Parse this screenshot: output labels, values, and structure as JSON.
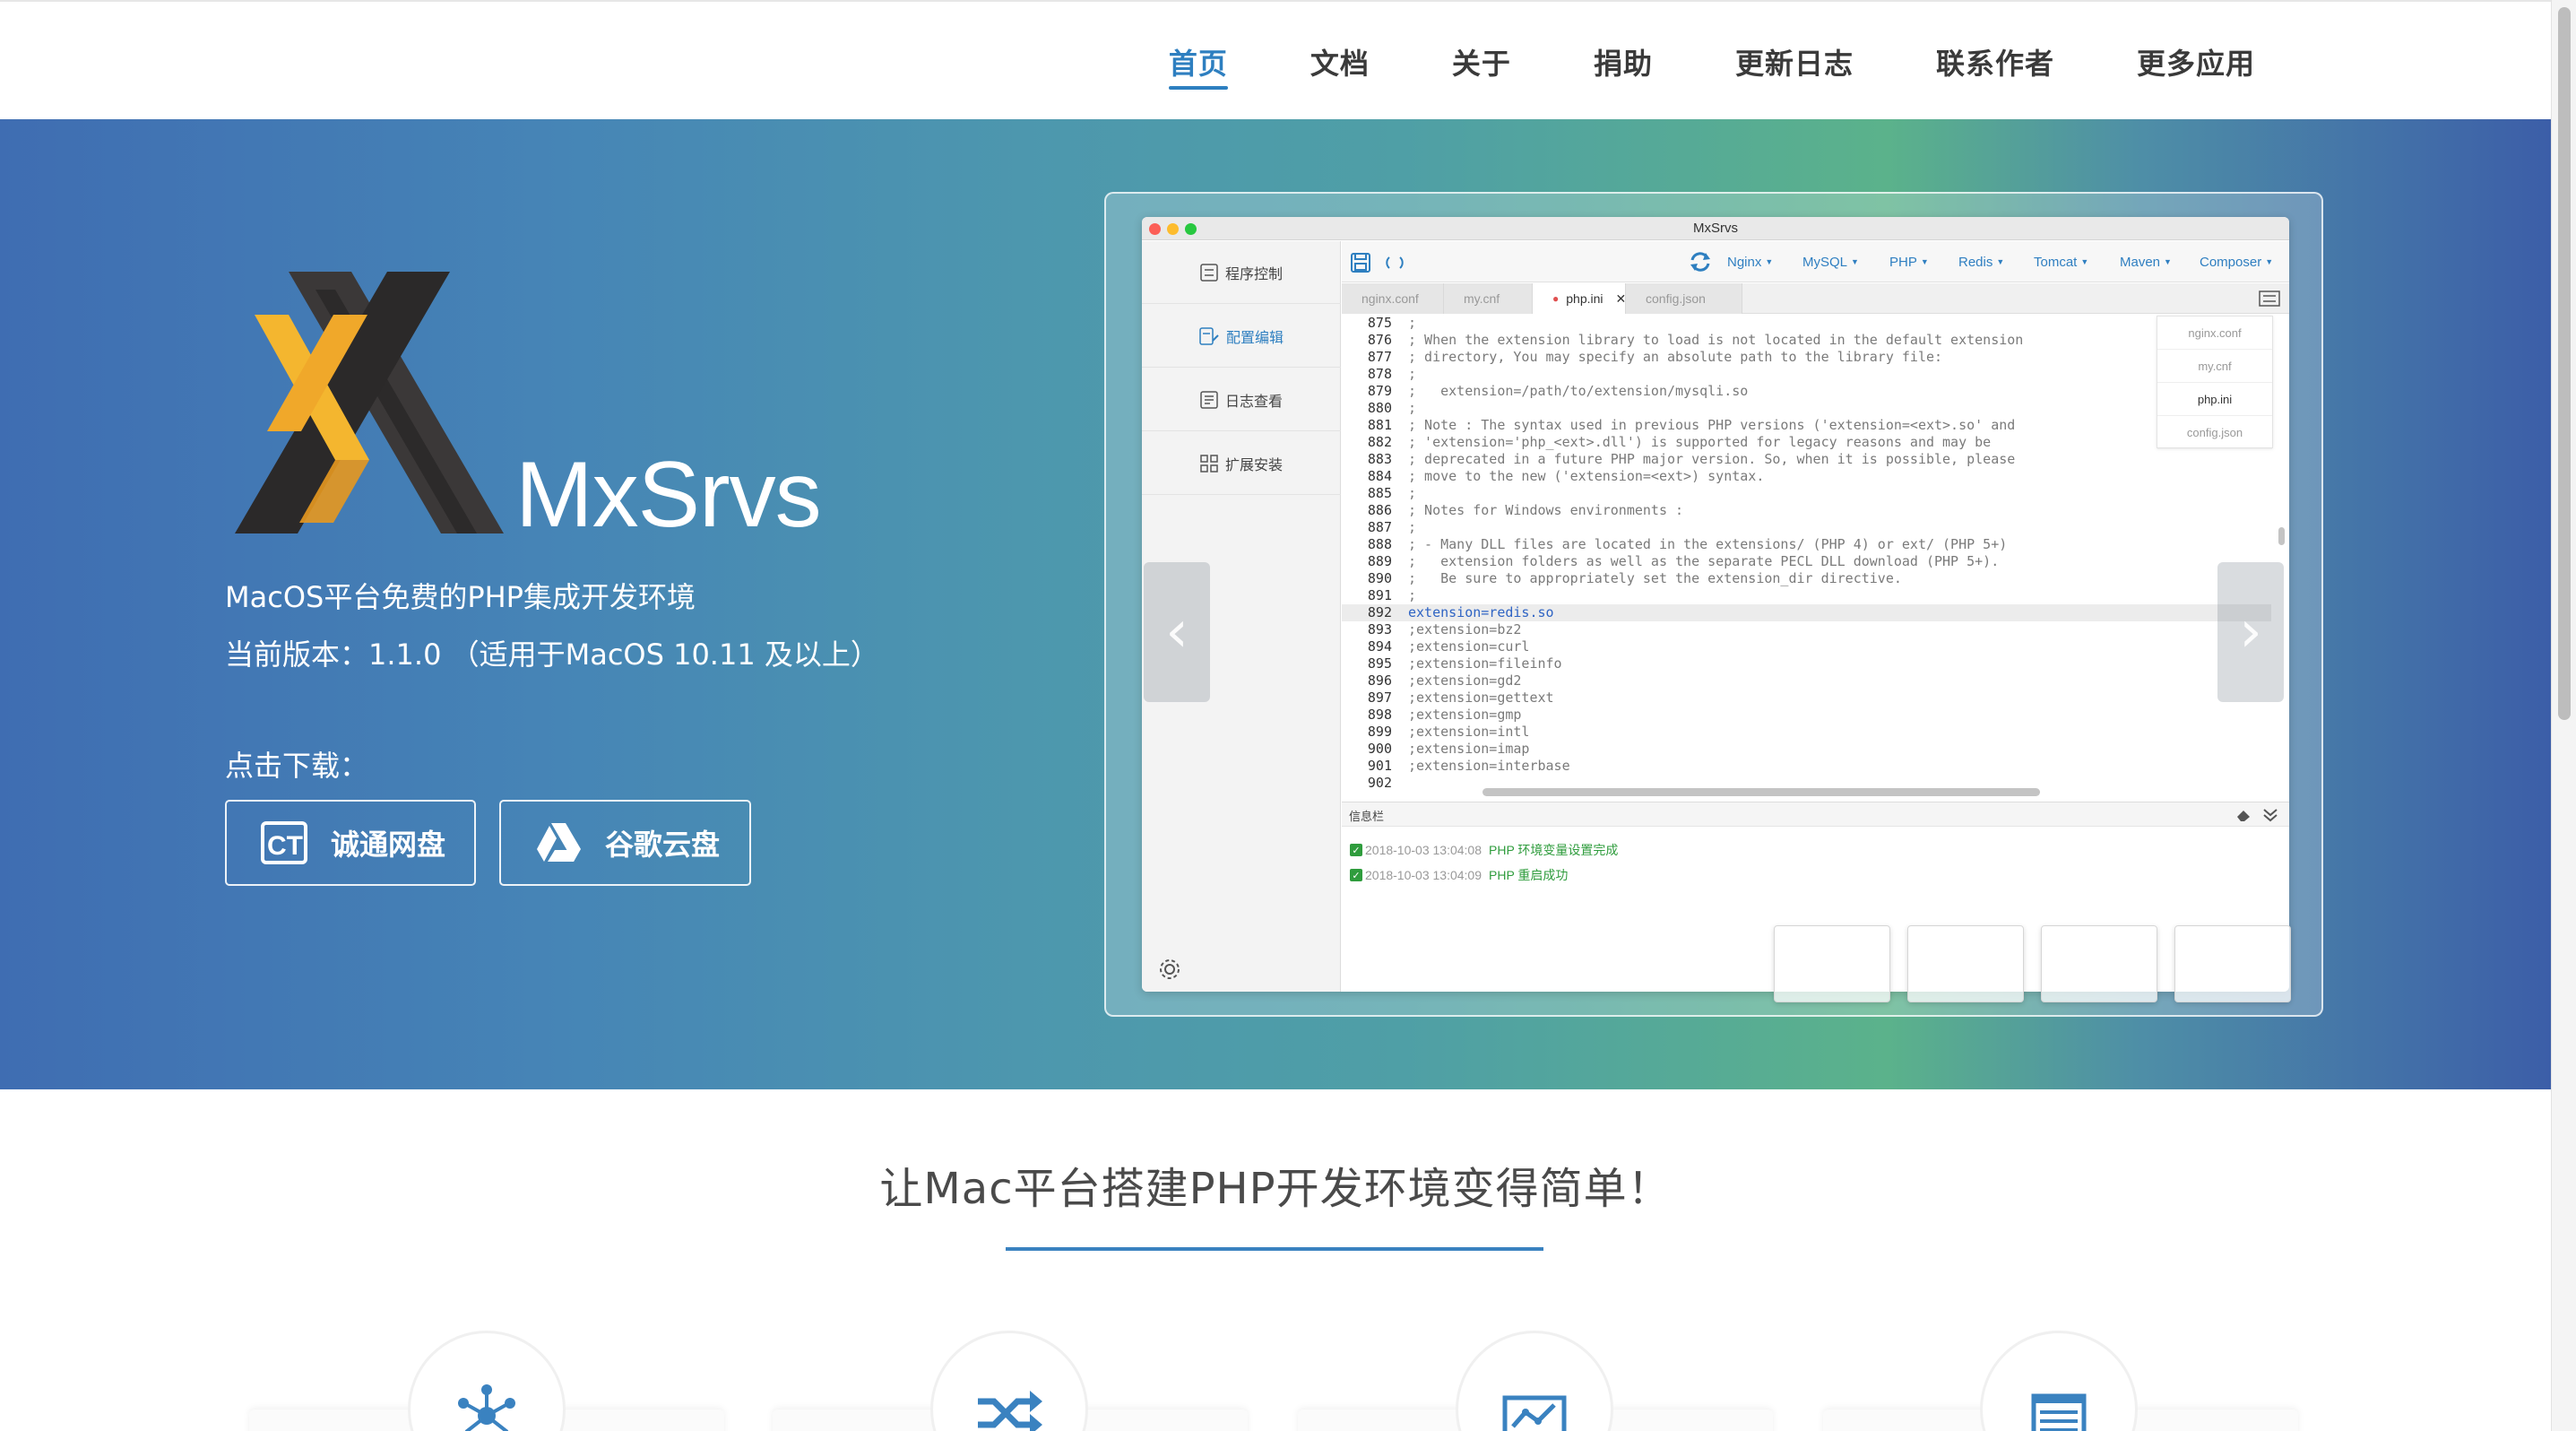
{
  "nav": {
    "items": [
      "首页",
      "文档",
      "关于",
      "捐助",
      "更新日志",
      "联系作者",
      "更多应用"
    ],
    "active_index": 0
  },
  "hero": {
    "brand": "MxSrvs",
    "subtitle": "MacOS平台免费的PHP集成开发环境",
    "version": "当前版本：1.1.0 （适用于MacOS 10.11 及以上）",
    "download_label": "点击下载：",
    "buttons": {
      "ct": "诚通网盘",
      "ct_icon_text": "CT",
      "google": "谷歌云盘"
    }
  },
  "app": {
    "title": "MxSrvs",
    "sidebar": [
      "程序控制",
      "配置编辑",
      "日志查看",
      "扩展安装"
    ],
    "sidebar_active": 1,
    "menus": [
      "Nginx",
      "MySQL",
      "PHP",
      "Redis",
      "Tomcat",
      "Maven",
      "Composer"
    ],
    "tabs": [
      "nginx.conf",
      "my.cnf",
      "php.ini",
      "config.json"
    ],
    "active_tab": "php.ini",
    "files": [
      "nginx.conf",
      "my.cnf",
      "php.ini",
      "config.json"
    ],
    "code": [
      {
        "n": "875",
        "t": ";"
      },
      {
        "n": "876",
        "t": "; When the extension library to load is not located in the default extension"
      },
      {
        "n": "877",
        "t": "; directory, You may specify an absolute path to the library file:"
      },
      {
        "n": "878",
        "t": ";"
      },
      {
        "n": "879",
        "t": ";   extension=/path/to/extension/mysqli.so"
      },
      {
        "n": "880",
        "t": ";"
      },
      {
        "n": "881",
        "t": "; Note : The syntax used in previous PHP versions ('extension=<ext>.so' and"
      },
      {
        "n": "882",
        "t": "; 'extension='php_<ext>.dll') is supported for legacy reasons and may be"
      },
      {
        "n": "883",
        "t": "; deprecated in a future PHP major version. So, when it is possible, please"
      },
      {
        "n": "884",
        "t": "; move to the new ('extension=<ext>) syntax."
      },
      {
        "n": "885",
        "t": ";"
      },
      {
        "n": "886",
        "t": "; Notes for Windows environments :"
      },
      {
        "n": "887",
        "t": ";"
      },
      {
        "n": "888",
        "t": "; - Many DLL files are located in the extensions/ (PHP 4) or ext/ (PHP 5+)"
      },
      {
        "n": "889",
        "t": ";   extension folders as well as the separate PECL DLL download (PHP 5+)."
      },
      {
        "n": "890",
        "t": ";   Be sure to appropriately set the extension_dir directive."
      },
      {
        "n": "891",
        "t": ";"
      },
      {
        "n": "892",
        "t": "extension=redis.so"
      },
      {
        "n": "893",
        "t": ";extension=bz2"
      },
      {
        "n": "894",
        "t": ";extension=curl"
      },
      {
        "n": "895",
        "t": ";extension=fileinfo"
      },
      {
        "n": "896",
        "t": ";extension=gd2"
      },
      {
        "n": "897",
        "t": ";extension=gettext"
      },
      {
        "n": "898",
        "t": ";extension=gmp"
      },
      {
        "n": "899",
        "t": ";extension=intl"
      },
      {
        "n": "900",
        "t": ";extension=imap"
      },
      {
        "n": "901",
        "t": ";extension=interbase"
      },
      {
        "n": "902",
        "t": ""
      }
    ],
    "highlight_line": "892",
    "infobar_label": "信息栏",
    "logs": [
      {
        "time": "2018-10-03 13:04:08",
        "msg": "PHP 环境变量设置完成"
      },
      {
        "time": "2018-10-03 13:04:09",
        "msg": "PHP 重启成功"
      }
    ]
  },
  "section": {
    "slogan": "让Mac平台搭建PHP开发环境变得简单！"
  },
  "colors": {
    "accent": "#2e7fc0",
    "log_green": "#2f9c3d",
    "logo_yellow": "#f2b12e"
  },
  "icons": [
    "ct-icon",
    "google-drive-icon",
    "hub-icon",
    "shuffle-icon",
    "chart-icon",
    "list-icon"
  ]
}
